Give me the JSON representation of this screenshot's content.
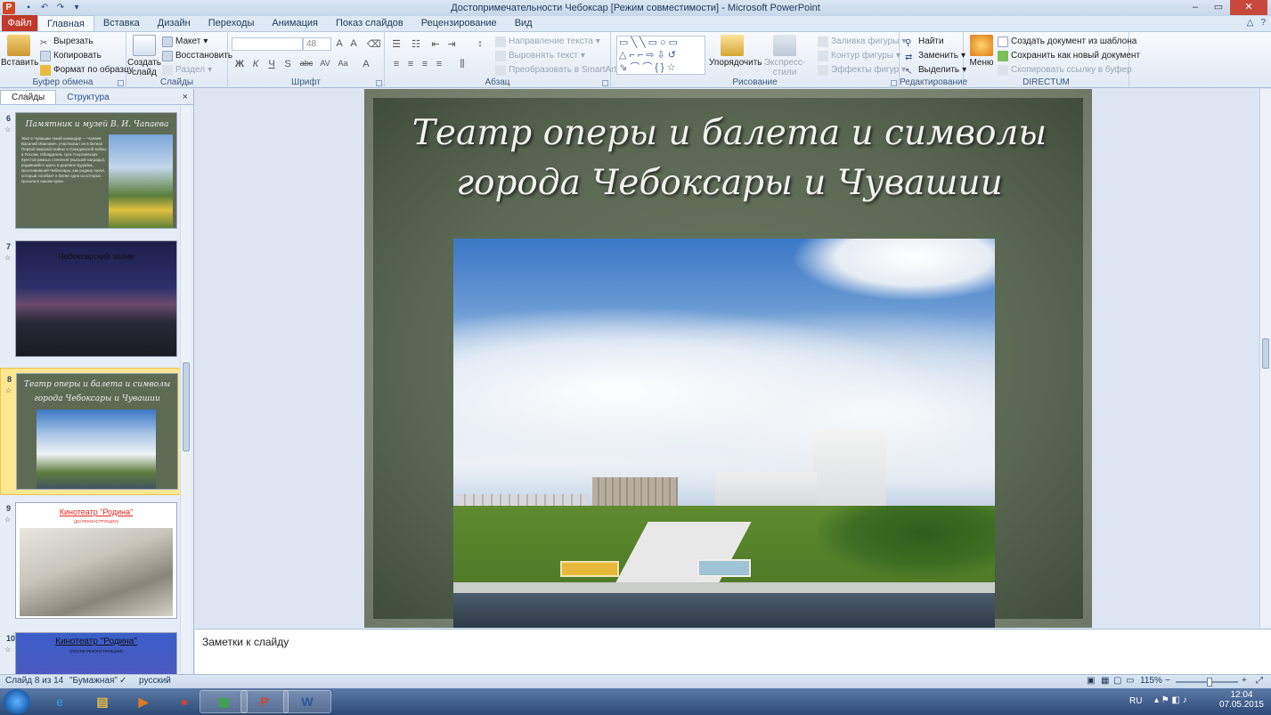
{
  "window": {
    "app_icon": "P",
    "title": "Достопримечательности Чебоксар [Режим совместимости]  -  Microsoft PowerPoint",
    "qat": [
      {
        "icon": "save-icon",
        "glyph": "▪"
      },
      {
        "icon": "undo-icon",
        "glyph": "↶"
      },
      {
        "icon": "redo-icon",
        "glyph": "↷"
      },
      {
        "icon": "customize-qat-icon",
        "glyph": "▾"
      }
    ],
    "controls": {
      "minimize": "–",
      "maximize": "▭",
      "close": "✕"
    }
  },
  "ribbon_tabs": {
    "file": "Файл",
    "tabs": [
      "Главная",
      "Вставка",
      "Дизайн",
      "Переходы",
      "Анимация",
      "Показ слайдов",
      "Рецензирование",
      "Вид"
    ],
    "active_index": 0,
    "right_icons": [
      "△",
      "?"
    ]
  },
  "ribbon": {
    "clipboard": {
      "name": "Буфер обмена",
      "paste": "Вставить",
      "cut": "Вырезать",
      "copy": "Копировать",
      "format_painter": "Формат по образцу"
    },
    "slides": {
      "name": "Слайды",
      "new_slide": "Создать слайд",
      "layout": "Макет",
      "reset": "Восстановить",
      "section": "Раздел"
    },
    "font": {
      "name": "Шрифт",
      "size": "48",
      "buttons": [
        "Ж",
        "К",
        "Ч",
        "S",
        "abc",
        "AV",
        "Aa",
        "A"
      ]
    },
    "paragraph": {
      "name": "Абзац",
      "text_direction": "Направление текста",
      "align_text": "Выровнять текст",
      "convert_smartart": "Преобразовать в SmartArt"
    },
    "drawing": {
      "name": "Рисование",
      "arrange": "Упорядочить",
      "quick_styles": "Экспресс-стили",
      "shape_fill": "Заливка фигуры",
      "shape_outline": "Контур фигуры",
      "shape_effects": "Эффекты фигур"
    },
    "editing": {
      "name": "Редактирование",
      "find": "Найти",
      "replace": "Заменить",
      "select": "Выделить"
    },
    "directum": {
      "name": "DIRECTUM",
      "menu": "Меню",
      "create_from_template": "Создать документ из шаблона",
      "save_as_new": "Сохранить как новый документ",
      "copy_link": "Скопировать ссылку в буфер"
    }
  },
  "left_panel": {
    "tabs": [
      "Слайды",
      "Структура"
    ],
    "close": "×",
    "slides": [
      {
        "number": "6",
        "title": "Памятник и музей В. И. Чапаева",
        "body": "Жил в Чувашии такой командир — Чапаев Василий Иванович, участвовал он в битвах Первой мировой войны и Гражданской войны в России. Обладатель трех Георгиевских Крестов разных степеней (высшей награды), родившийся здесь в деревне Будайка, прославивший Чебоксары, как родину героя, который погибает в битве одна из которых прошла в нашем краю."
      },
      {
        "number": "7",
        "title": "Чебоксарский залив"
      },
      {
        "number": "8",
        "title": "Театр оперы и балета и символы города Чебоксары и Чувашии",
        "selected": true
      },
      {
        "number": "9",
        "title": "Кинотеатр \"Родина\"",
        "subtitle": "(ДО РЕКОНСТРУКЦИИ)"
      },
      {
        "number": "10",
        "title": "Кинотеатр \"Родина\"",
        "subtitle": "(ПОСЛЕ РЕКОНСТРУКЦИИ)"
      }
    ]
  },
  "slide": {
    "title": "Театр оперы и балета и символы города Чебоксары и Чувашии"
  },
  "notes": {
    "placeholder": "Заметки к слайду"
  },
  "statusbar": {
    "slide_info": "Слайд 8 из 14",
    "theme": "\"Бумажная\"",
    "language": "русский",
    "zoom": "115%",
    "zoom_minus": "−",
    "zoom_plus": "+"
  },
  "taskbar": {
    "apps": [
      {
        "icon": "internet-explorer-icon",
        "glyph": "e",
        "color": "#2f8fd6"
      },
      {
        "icon": "file-explorer-icon",
        "glyph": "▤",
        "color": "#e5b94a"
      },
      {
        "icon": "media-player-icon",
        "glyph": "▶",
        "color": "#e07a1f"
      },
      {
        "icon": "chrome-icon",
        "glyph": "●",
        "color": "#d9402c"
      },
      {
        "icon": "project-icon",
        "glyph": "▦",
        "color": "#3fa34d"
      },
      {
        "icon": "powerpoint-icon",
        "glyph": "P",
        "color": "#d24726"
      },
      {
        "icon": "word-icon",
        "glyph": "W",
        "color": "#2b579a"
      }
    ],
    "keyboard_lang": "RU",
    "time": "12:04",
    "date": "07.05.2015"
  },
  "colors": {
    "file_tab": "#c0392b",
    "selected_slide": "#fde792",
    "slide_bg": "#5a6853",
    "thumb9_title": "#e0281f",
    "thumb10_bg": "#3b5ec9"
  }
}
